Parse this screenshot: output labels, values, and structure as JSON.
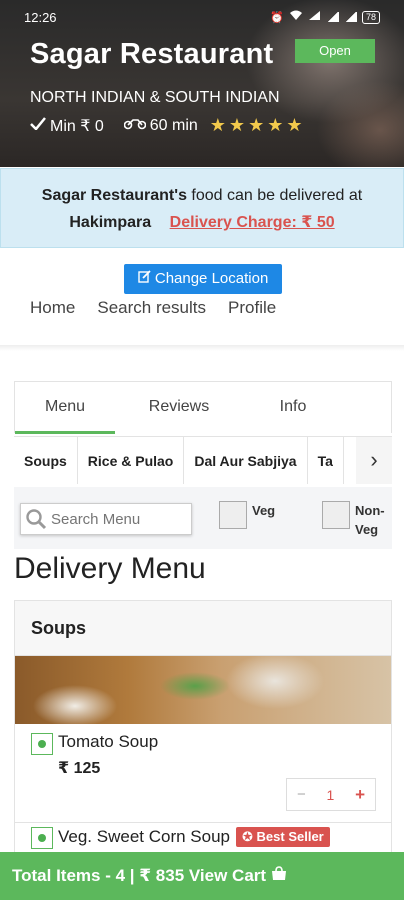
{
  "status_bar": {
    "time": "12:26",
    "battery": "78"
  },
  "restaurant": {
    "name": "Sagar Restaurant",
    "status": "Open",
    "cuisine": "NORTH INDIAN & SOUTH INDIAN",
    "min_order": "Min ₹ 0",
    "delivery_time": "60 min",
    "rating_stars": 5
  },
  "delivery": {
    "name_bold": "Sagar Restaurant's",
    "text": "food can be delivered at",
    "location": "Hakimpara",
    "charge_label": "Delivery Charge: ₹ 50"
  },
  "actions": {
    "change_location": "Change Location"
  },
  "breadcrumb": [
    "Home",
    "Search results",
    "Profile"
  ],
  "tabs": [
    {
      "label": "Menu",
      "active": true
    },
    {
      "label": "Reviews",
      "active": false
    },
    {
      "label": "Info",
      "active": false
    }
  ],
  "categories": [
    "Soups",
    "Rice & Pulao",
    "Dal Aur Sabjiya",
    "Ta"
  ],
  "filters": {
    "search_placeholder": "Search Menu",
    "veg_label": "Veg",
    "nonveg_label": "Non-Veg"
  },
  "menu": {
    "title": "Delivery Menu",
    "section": "Soups",
    "items": [
      {
        "name": "Tomato Soup",
        "price": "₹ 125",
        "quantity": "1"
      },
      {
        "name": "Veg. Sweet Corn Soup",
        "badge": "Best Seller"
      }
    ]
  },
  "cart": {
    "summary": "Total Items - 4 | ₹ 835 View Cart"
  },
  "colors": {
    "accent_green": "#5cb85c",
    "accent_blue": "#1e88e5",
    "accent_red": "#d9534f",
    "info_bg": "#d9edf7"
  }
}
